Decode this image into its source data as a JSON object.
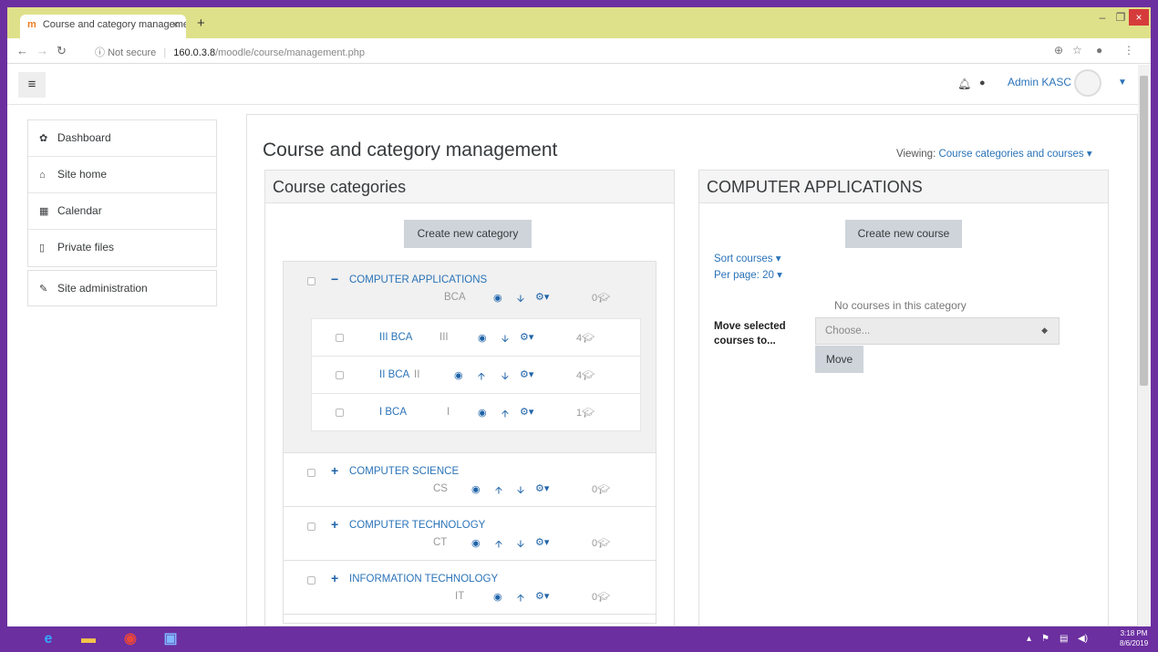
{
  "browser": {
    "tab_title": "Course and category manageme",
    "tab_close": "×",
    "new_tab": "+",
    "security": "Not secure",
    "host": "160.0.3.8",
    "path": "/moodle/course/management.php",
    "min": "–",
    "max": "❐",
    "close": "×"
  },
  "navbar": {
    "menu_icon": "≡",
    "user_name": "Admin KASC"
  },
  "left_nav": {
    "items": [
      {
        "icon": "tachometer-icon",
        "label": "Dashboard"
      },
      {
        "icon": "home-icon",
        "label": "Site home"
      },
      {
        "icon": "calendar-icon",
        "label": "Calendar"
      },
      {
        "icon": "file-icon",
        "label": "Private files"
      }
    ],
    "admin": {
      "icon": "wrench-icon",
      "label": "Site administration"
    }
  },
  "page": {
    "title": "Course and category management",
    "viewing_label": "Viewing:",
    "viewing_value": "Course categories and courses"
  },
  "categories_panel": {
    "heading": "Course categories",
    "create_button": "Create new category",
    "categories": [
      {
        "name": "COMPUTER APPLICATIONS",
        "idnumber": "BCA",
        "count": "0",
        "expanded": true
      },
      {
        "name": "COMPUTER SCIENCE",
        "idnumber": "CS",
        "count": "0",
        "expanded": false
      },
      {
        "name": "COMPUTER TECHNOLOGY",
        "idnumber": "CT",
        "count": "0",
        "expanded": false
      },
      {
        "name": "INFORMATION TECHNOLOGY",
        "idnumber": "IT",
        "count": "0",
        "expanded": false
      }
    ],
    "subcategories": [
      {
        "name": "III BCA",
        "idnumber": "III",
        "count": "4"
      },
      {
        "name": "II BCA",
        "idnumber": "II",
        "count": "4"
      },
      {
        "name": "I BCA",
        "idnumber": "I",
        "count": "1"
      }
    ]
  },
  "courses_panel": {
    "heading": "COMPUTER APPLICATIONS",
    "create_button": "Create new course",
    "sort_label": "Sort courses",
    "per_page_label": "Per page: 20",
    "empty_message": "No courses in this category",
    "move_label": "Move selected courses to...",
    "select_placeholder": "Choose...",
    "move_button": "Move"
  },
  "taskbar": {
    "time": "3:18 PM",
    "date": "8/6/2019"
  },
  "colors": {
    "link": "#2a73b8",
    "accent_purple": "#6b2fa0",
    "tabbar": "#dfe08a"
  }
}
